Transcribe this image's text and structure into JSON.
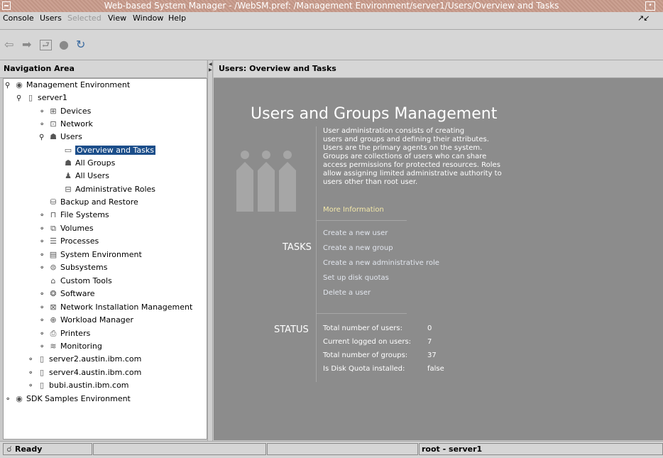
{
  "window": {
    "title": "Web-based System Manager - /WebSM.pref: /Management Environment/server1/Users/Overview and Tasks"
  },
  "menubar": {
    "items": [
      {
        "label": "Console",
        "disabled": false
      },
      {
        "label": "Users",
        "disabled": false
      },
      {
        "label": "Selected",
        "disabled": true
      },
      {
        "label": "View",
        "disabled": false
      },
      {
        "label": "Window",
        "disabled": false
      },
      {
        "label": "Help",
        "disabled": false
      }
    ],
    "window_controls": "↗↙"
  },
  "toolbar": {
    "buttons": [
      "back-arrow-icon",
      "forward-arrow-icon",
      "up-level-icon",
      "stop-icon",
      "refresh-icon"
    ]
  },
  "nav": {
    "header": "Navigation Area",
    "items": [
      {
        "label": "Management Environment",
        "icon": "management-environment-icon",
        "toggle": "expanded"
      },
      {
        "label": "server1",
        "icon": "server-icon",
        "toggle": "expanded"
      },
      {
        "label": "Devices",
        "icon": "devices-icon",
        "toggle": "collapsed"
      },
      {
        "label": "Network",
        "icon": "network-icon",
        "toggle": "collapsed"
      },
      {
        "label": "Users",
        "icon": "users-icon",
        "toggle": "expanded"
      },
      {
        "label": "Overview and Tasks",
        "icon": "overview-icon",
        "toggle": "none",
        "selected": true
      },
      {
        "label": "All Groups",
        "icon": "groups-icon",
        "toggle": "none"
      },
      {
        "label": "All Users",
        "icon": "user-icon",
        "toggle": "none"
      },
      {
        "label": "Administrative Roles",
        "icon": "roles-icon",
        "toggle": "none"
      },
      {
        "label": "Backup and Restore",
        "icon": "backup-icon",
        "toggle": "none"
      },
      {
        "label": "File Systems",
        "icon": "file-systems-icon",
        "toggle": "collapsed"
      },
      {
        "label": "Volumes",
        "icon": "volumes-icon",
        "toggle": "collapsed"
      },
      {
        "label": "Processes",
        "icon": "processes-icon",
        "toggle": "collapsed"
      },
      {
        "label": "System Environment",
        "icon": "system-environment-icon",
        "toggle": "collapsed"
      },
      {
        "label": "Subsystems",
        "icon": "subsystems-icon",
        "toggle": "collapsed"
      },
      {
        "label": "Custom Tools",
        "icon": "custom-tools-icon",
        "toggle": "none"
      },
      {
        "label": "Software",
        "icon": "software-icon",
        "toggle": "collapsed"
      },
      {
        "label": "Network Installation Management",
        "icon": "nim-icon",
        "toggle": "collapsed"
      },
      {
        "label": "Workload Manager",
        "icon": "workload-icon",
        "toggle": "collapsed"
      },
      {
        "label": "Printers",
        "icon": "printer-icon",
        "toggle": "collapsed"
      },
      {
        "label": "Monitoring",
        "icon": "monitoring-icon",
        "toggle": "collapsed"
      },
      {
        "label": "server2.austin.ibm.com",
        "icon": "server-icon",
        "toggle": "collapsed"
      },
      {
        "label": "server4.austin.ibm.com",
        "icon": "server-icon",
        "toggle": "collapsed"
      },
      {
        "label": "bubi.austin.ibm.com",
        "icon": "server-icon",
        "toggle": "collapsed"
      },
      {
        "label": "SDK Samples Environment",
        "icon": "management-environment-icon",
        "toggle": "collapsed"
      }
    ]
  },
  "main": {
    "header": "Users: Overview and Tasks",
    "title": "Users and Groups Management",
    "description_lines": [
      "User administration consists of creating",
      "users and groups and defining their attributes.",
      "Users are the primary agents on the system.",
      "Groups are collections of users who can share",
      "access permissions for protected resources.  Roles",
      "allow assigning limited administrative authority to",
      "users other than root user."
    ],
    "more_info": "More Information",
    "tasks_label": "TASKS",
    "tasks": [
      "Create a new user",
      "Create a new group",
      "Create a new administrative role",
      "Set up disk quotas",
      "Delete a user"
    ],
    "status_label": "STATUS",
    "status": [
      {
        "label": "Total number of users:",
        "value": "0"
      },
      {
        "label": "Current logged on users:",
        "value": "7"
      },
      {
        "label": "Total number of groups:",
        "value": "37"
      },
      {
        "label": "Is Disk Quota installed:",
        "value": "false"
      }
    ]
  },
  "statusbar": {
    "status": "Ready",
    "user_host": "root - server1"
  }
}
